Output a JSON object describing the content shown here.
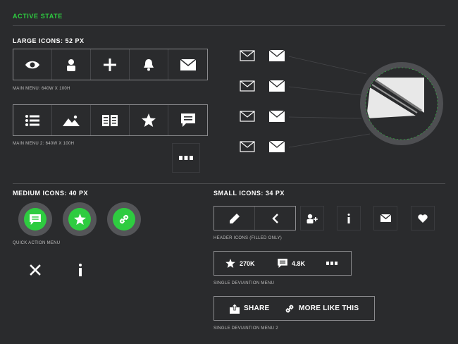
{
  "header": {
    "title": "ACTIVE STATE"
  },
  "large": {
    "title": "LARGE ICONS: 52 PX",
    "main_menu_caption": "MAIN MENU: 640W X 100H",
    "main_menu2_caption": "MAIN MENU 2: 640W X 100H",
    "main_menu_icons": [
      "eye-icon",
      "user-icon",
      "plus-icon",
      "bell-icon",
      "mail-icon"
    ],
    "main_menu2_icons": [
      "list-icon",
      "image-icon",
      "book-icon",
      "star-icon",
      "comment-icon"
    ],
    "more_icon": "more-dots-icon"
  },
  "medium": {
    "title": "MEDIUM ICONS: 40 PX",
    "quick_caption": "QUICK ACTION MENU",
    "quick_icons": [
      "comment-icon",
      "star-icon",
      "link-icon"
    ],
    "other_icons": [
      "close-icon",
      "info-icon"
    ]
  },
  "small": {
    "title": "SMALL ICONS: 34 PX",
    "header_caption": "HEADER ICONS (FILLED ONLY)",
    "header_icons": [
      "pencil-icon",
      "back-icon"
    ],
    "extra_icons": [
      "add-user-icon",
      "info-icon",
      "mail-icon",
      "heart-icon"
    ],
    "deviation": {
      "caption": "SINGLE DEVIANTION MENU",
      "favorites": "270K",
      "comments": "4.8K"
    },
    "deviation2": {
      "caption": "SINGLE DEVIANTION MENU 2",
      "share_label": "SHARE",
      "more_like_label": "MORE LIKE THIS"
    }
  },
  "colors": {
    "accent": "#2ecc40",
    "background": "#2a2b2d",
    "border": "#8a8a8d"
  }
}
